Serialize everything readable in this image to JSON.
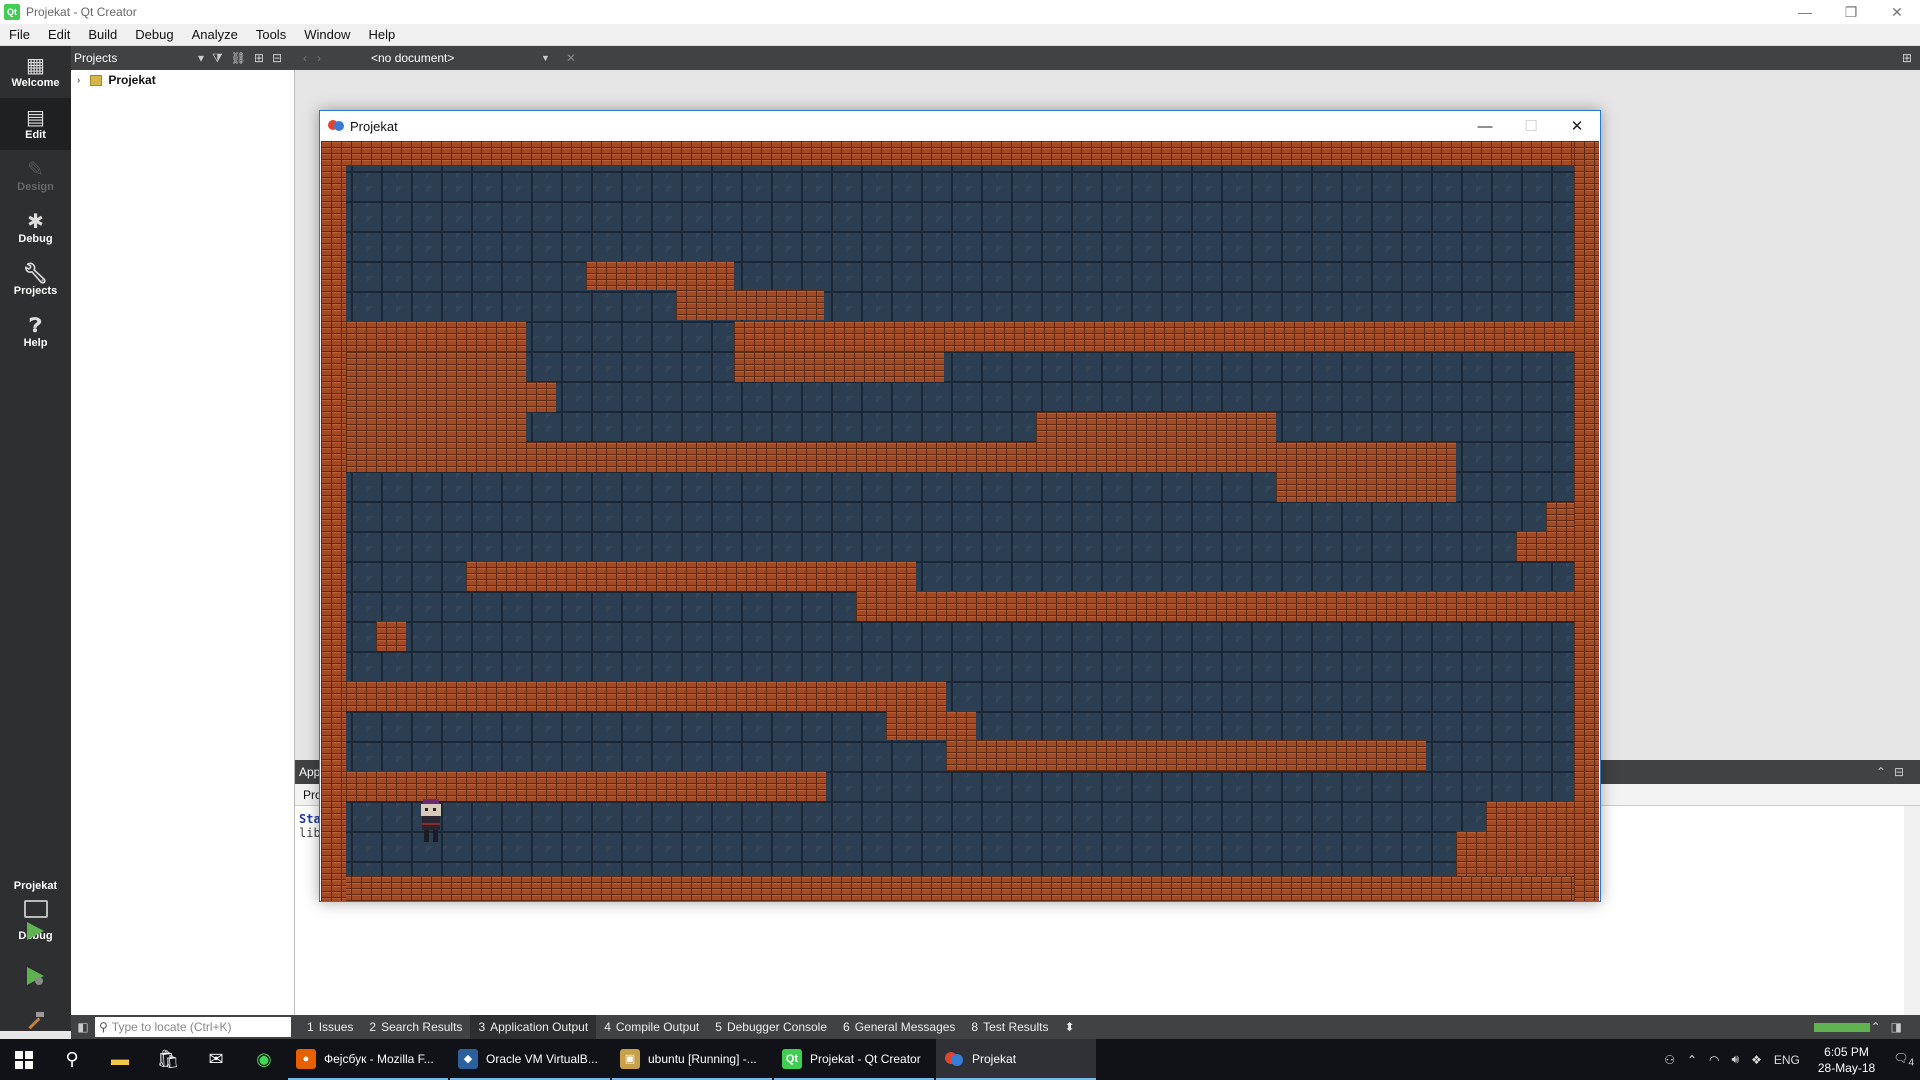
{
  "window": {
    "title": "Projekat - Qt Creator",
    "controls": {
      "minimize": "—",
      "restore": "❐",
      "close": "✕"
    }
  },
  "menu": [
    "File",
    "Edit",
    "Build",
    "Debug",
    "Analyze",
    "Tools",
    "Window",
    "Help"
  ],
  "modes": [
    {
      "label": "Welcome",
      "icon": "grid-icon",
      "state": "normal"
    },
    {
      "label": "Edit",
      "icon": "edit-doc-icon",
      "state": "active"
    },
    {
      "label": "Design",
      "icon": "pencil-icon",
      "state": "disabled"
    },
    {
      "label": "Debug",
      "icon": "bug-icon",
      "state": "normal"
    },
    {
      "label": "Projects",
      "icon": "wrench-icon",
      "state": "normal"
    },
    {
      "label": "Help",
      "icon": "help-icon",
      "state": "normal"
    }
  ],
  "kit": {
    "project": "Projekat",
    "build": "Debug"
  },
  "sidebar": {
    "combo": "Projects",
    "tree": [
      {
        "label": "Projekat"
      }
    ]
  },
  "editor": {
    "document_combo": "<no document>"
  },
  "output_pane": {
    "header_partial": "App",
    "tab_partial": "Pro",
    "line1_partial": "Sta",
    "line2_partial": "lib"
  },
  "locator": {
    "placeholder": "Type to locate (Ctrl+K)"
  },
  "output_tabs": [
    {
      "num": "1",
      "label": "Issues"
    },
    {
      "num": "2",
      "label": "Search Results"
    },
    {
      "num": "3",
      "label": "Application Output",
      "active": true
    },
    {
      "num": "4",
      "label": "Compile Output"
    },
    {
      "num": "5",
      "label": "Debugger Console"
    },
    {
      "num": "6",
      "label": "General Messages"
    },
    {
      "num": "8",
      "label": "Test Results"
    }
  ],
  "game_window": {
    "title": "Projekat",
    "controls": {
      "minimize": "—",
      "maximize": "☐",
      "close": "✕"
    }
  },
  "taskbar": {
    "apps": [
      {
        "label": "Фејсбук - Mozilla F...",
        "icon": "firefox-icon",
        "color": "#e66000"
      },
      {
        "label": "Oracle VM VirtualB...",
        "icon": "virtualbox-icon",
        "color": "#2b5f9e"
      },
      {
        "label": "ubuntu [Running] -...",
        "icon": "vm-window-icon",
        "color": "#c9a04a"
      },
      {
        "label": "Projekat - Qt Creator",
        "icon": "qt-icon",
        "color": "#41cd52"
      },
      {
        "label": "Projekat",
        "icon": "app-icon",
        "color": "#e0442a",
        "active": true
      }
    ],
    "tray": {
      "language": "ENG",
      "time": "6:05 PM",
      "date": "28-May-18",
      "notifications": "4"
    }
  },
  "colors": {
    "brick": "#a14a23",
    "stone": "#2c3e52",
    "qt_green": "#41cd52",
    "accent": "#2b78c9"
  }
}
